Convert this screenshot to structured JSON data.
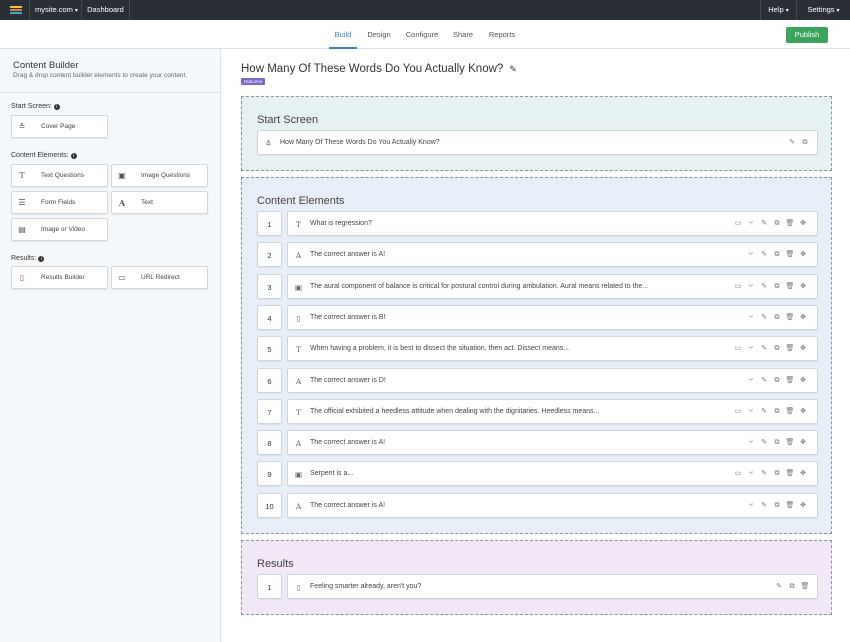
{
  "topbar": {
    "site": "mysite.com",
    "dashboard": "Dashboard",
    "help": "Help",
    "settings": "Settings"
  },
  "tabs": [
    {
      "label": "Build",
      "active": true
    },
    {
      "label": "Design",
      "active": false
    },
    {
      "label": "Configure",
      "active": false
    },
    {
      "label": "Share",
      "active": false
    },
    {
      "label": "Reports",
      "active": false
    }
  ],
  "publish_label": "Publish",
  "sidebar": {
    "title": "Content Builder",
    "subtitle": "Drag & drop content builder elements to create your content.",
    "start_label": "Start Screen:",
    "content_label": "Content Elements:",
    "results_label": "Results:",
    "start_items": [
      {
        "label": "Cover Page",
        "icon": "cover-page-icon"
      }
    ],
    "content_items": [
      {
        "label": "Text Questions",
        "icon": "text-icon"
      },
      {
        "label": "Image Questions",
        "icon": "image-icon"
      },
      {
        "label": "Form Fields",
        "icon": "form-icon"
      },
      {
        "label": "Text",
        "icon": "letter-a-icon"
      },
      {
        "label": "Image or Video",
        "icon": "media-icon"
      }
    ],
    "results_items": [
      {
        "label": "Results Builder",
        "icon": "document-icon"
      },
      {
        "label": "URL Redirect",
        "icon": "monitor-icon"
      }
    ]
  },
  "main": {
    "title": "How Many Of These Words Do You Actually Know?",
    "badge": "Outcome",
    "start_heading": "Start Screen",
    "start_item": "How Many Of These Words Do You Actually Know?",
    "content_heading": "Content Elements",
    "items": [
      {
        "num": "1",
        "text": "What is regression?",
        "type": "text",
        "logic": true
      },
      {
        "num": "2",
        "text": "The correct answer is A!",
        "type": "letter",
        "logic": false
      },
      {
        "num": "3",
        "text": "The aural component of balance is critical for postural control during ambulation. Aural means related to the...",
        "type": "image",
        "logic": true
      },
      {
        "num": "4",
        "text": "The correct answer is B!",
        "type": "doc",
        "logic": false
      },
      {
        "num": "5",
        "text": "When having a problem, it is best to dissect the situation, then act. Dissect means...",
        "type": "text",
        "logic": true
      },
      {
        "num": "6",
        "text": "The correct answer is D!",
        "type": "letter",
        "logic": false
      },
      {
        "num": "7",
        "text": "The official exhibited a heedless attitude when dealing with the dignitaries. Heedless means...",
        "type": "text",
        "logic": true
      },
      {
        "num": "8",
        "text": "The correct answer is A!",
        "type": "letter",
        "logic": false
      },
      {
        "num": "9",
        "text": "Serpent is a...",
        "type": "image",
        "logic": true
      },
      {
        "num": "10",
        "text": "The correct answer is A!",
        "type": "letter",
        "logic": false
      }
    ],
    "results_heading": "Results",
    "results": [
      {
        "num": "1",
        "text": "Feeling smarter already, aren't you?"
      }
    ]
  },
  "colors": {
    "accent": "#3b82c4",
    "publish": "#3ba35b",
    "badge": "#7b68c8",
    "start_bg": "#e6f1f1",
    "content_bg": "#e8eef8",
    "results_bg": "#f2e7f6"
  }
}
